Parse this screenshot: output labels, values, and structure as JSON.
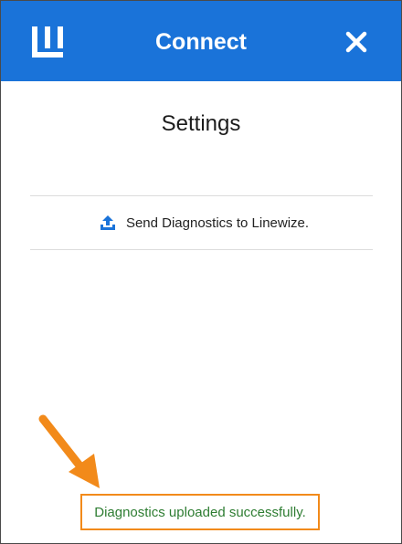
{
  "header": {
    "title": "Connect",
    "logo_icon": "linewize-logo-icon",
    "close_icon": "close-icon",
    "background_color": "#1a73d9"
  },
  "settings": {
    "title": "Settings",
    "items": [
      {
        "label": "Send Diagnostics to Linewize.",
        "icon": "upload-icon"
      }
    ]
  },
  "status": {
    "message": "Diagnostics uploaded successfully.",
    "text_color": "#2e7d32",
    "highlight_color": "#f28a1a"
  },
  "annotation": {
    "arrow_icon": "arrow-icon",
    "color": "#f28a1a"
  }
}
